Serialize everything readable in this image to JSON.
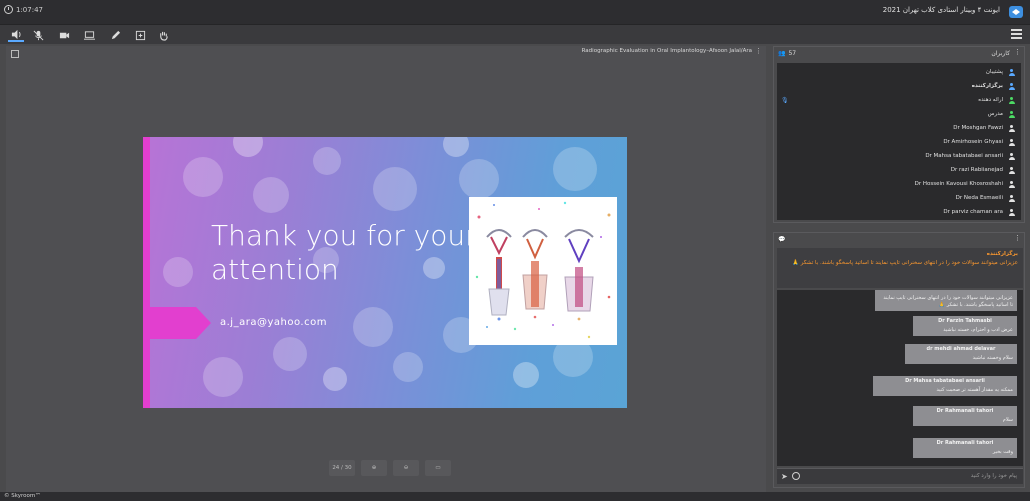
{
  "header": {
    "timer": "1:07:47",
    "room_title": "ایونت ۴ وبینار استادی کلاب تهران 2021"
  },
  "toolbar": {
    "tools": [
      "speaker-icon",
      "mic-off-icon",
      "camera-icon",
      "screen-share-icon",
      "pen-icon",
      "add-content-icon",
      "raise-hand-icon"
    ],
    "menu": "menu-icon"
  },
  "stage": {
    "title": "Radiographic Evaluation in Oral Implantology–Afsoon Jalal/Ara",
    "slide": {
      "heading": "Thank you for your attention",
      "email": "a.j_ara@yahoo.com"
    },
    "controls": [
      "24 / 30",
      "",
      "",
      ""
    ]
  },
  "users_panel": {
    "count": "57",
    "label": "کاربران",
    "users": [
      {
        "name": "پشتیبان",
        "bold": false,
        "color": "#5aa9ff"
      },
      {
        "name": "برگزارکننده",
        "bold": true,
        "color": "#5aa9ff"
      },
      {
        "name": "ارائه دهنده",
        "bold": false,
        "color": "#4cd964"
      },
      {
        "name": "مدرس",
        "bold": false,
        "color": "#4cd964"
      },
      {
        "name": "Dr Moshgan Fawzi",
        "bold": false,
        "color": "#e2e2e2"
      },
      {
        "name": "Dr Amirhosein Ghyasi",
        "bold": false,
        "color": "#e2e2e2"
      },
      {
        "name": "Dr Mahsa tabatabaei ansarii",
        "bold": false,
        "color": "#e2e2e2"
      },
      {
        "name": "Dr razi Rabiianejad",
        "bold": false,
        "color": "#e2e2e2"
      },
      {
        "name": "Dr Hossein Kavousi Khosroshahi",
        "bold": false,
        "color": "#e2e2e2"
      },
      {
        "name": "Dr Neda Esmaeili",
        "bold": false,
        "color": "#e2e2e2"
      },
      {
        "name": "Dr parviz chaman ara",
        "bold": false,
        "color": "#e2e2e2"
      }
    ]
  },
  "chat": {
    "pinned": {
      "author": "برگزارکننده",
      "text": "عزیزانی میتوانند سوالات خود را در انتهای سخنرانی تایپ نمایند تا اساتید پاسخگو باشند. با تشکر 🙏"
    },
    "messages": [
      {
        "author": "",
        "text": "عزیزانی میتوانند سوالات خود را در انتهای سخنرانی تایپ نمایند تا اساتید پاسخگو باشند. با تشکر 🙏"
      },
      {
        "author": "Dr Farzin Tahmasbi",
        "text": "عرض ادب و احترام، خسته نباشید"
      },
      {
        "author": "dr mehdi ahmad delavar",
        "text": "سلام وخسته نباشید"
      },
      {
        "author": "Dr Mahsa tabatabaei ansarii",
        "text": "ممکنه یه مقدار آهسته تر صحبت کنید"
      },
      {
        "author": "Dr Rahmanali tahori",
        "text": "سلام"
      },
      {
        "author": "Dr Rahmanali tahori",
        "text": "وقت بخیر"
      }
    ],
    "placeholder": "پیام خود را وارد کنید"
  },
  "footer": {
    "brand": "© Skyroom™"
  }
}
